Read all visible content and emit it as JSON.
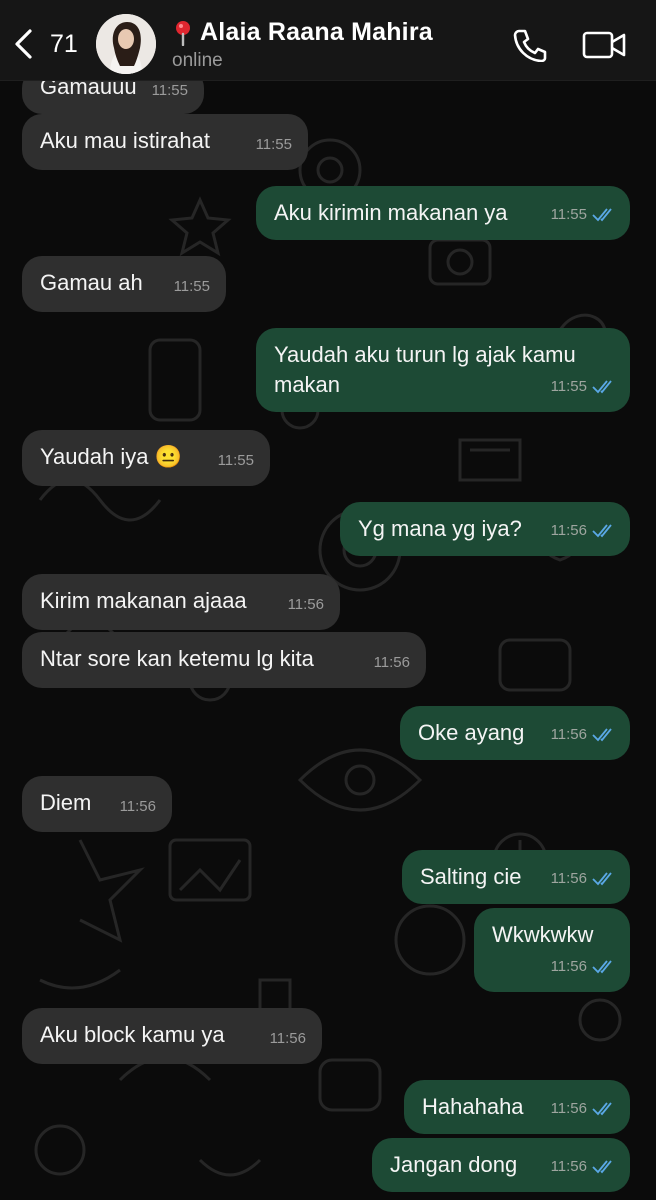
{
  "header": {
    "back_count": "71",
    "contact_name": "Alaia Raana Mahira",
    "status": "online",
    "icons": [
      "back-chevron-icon",
      "pin-icon",
      "phone-call-icon",
      "video-call-icon"
    ]
  },
  "colors": {
    "incoming_bubble": "#2f2f2f",
    "outgoing_bubble": "#1d4a35",
    "read_ticks": "#5aa8e6",
    "header_bg": "#161616"
  },
  "messages": [
    {
      "text": "Gamauuu",
      "time": "11:55",
      "dir": "in"
    },
    {
      "text": "Aku mau istirahat",
      "time": "11:55",
      "dir": "in"
    },
    {
      "text": "Aku kirimin makanan ya",
      "time": "11:55",
      "dir": "out"
    },
    {
      "text": "Gamau ah",
      "time": "11:55",
      "dir": "in"
    },
    {
      "text": "Yaudah aku turun lg ajak kamu\nmakan",
      "time": "11:55",
      "dir": "out"
    },
    {
      "text": "Yaudah iya 😐",
      "time": "11:55",
      "dir": "in"
    },
    {
      "text": "Yg mana yg iya?",
      "time": "11:56",
      "dir": "out"
    },
    {
      "text": "Kirim makanan ajaaa",
      "time": "11:56",
      "dir": "in"
    },
    {
      "text": "Ntar sore kan ketemu lg kita",
      "time": "11:56",
      "dir": "in"
    },
    {
      "text": "Oke ayang",
      "time": "11:56",
      "dir": "out"
    },
    {
      "text": "Diem",
      "time": "11:56",
      "dir": "in"
    },
    {
      "text": "Salting cie",
      "time": "11:56",
      "dir": "out"
    },
    {
      "text": "Wkwkwkw",
      "time": "11:56",
      "dir": "out"
    },
    {
      "text": "Aku block kamu ya",
      "time": "11:56",
      "dir": "in"
    },
    {
      "text": "Hahahaha",
      "time": "11:56",
      "dir": "out"
    },
    {
      "text": "Jangan dong",
      "time": "11:56",
      "dir": "out"
    }
  ]
}
